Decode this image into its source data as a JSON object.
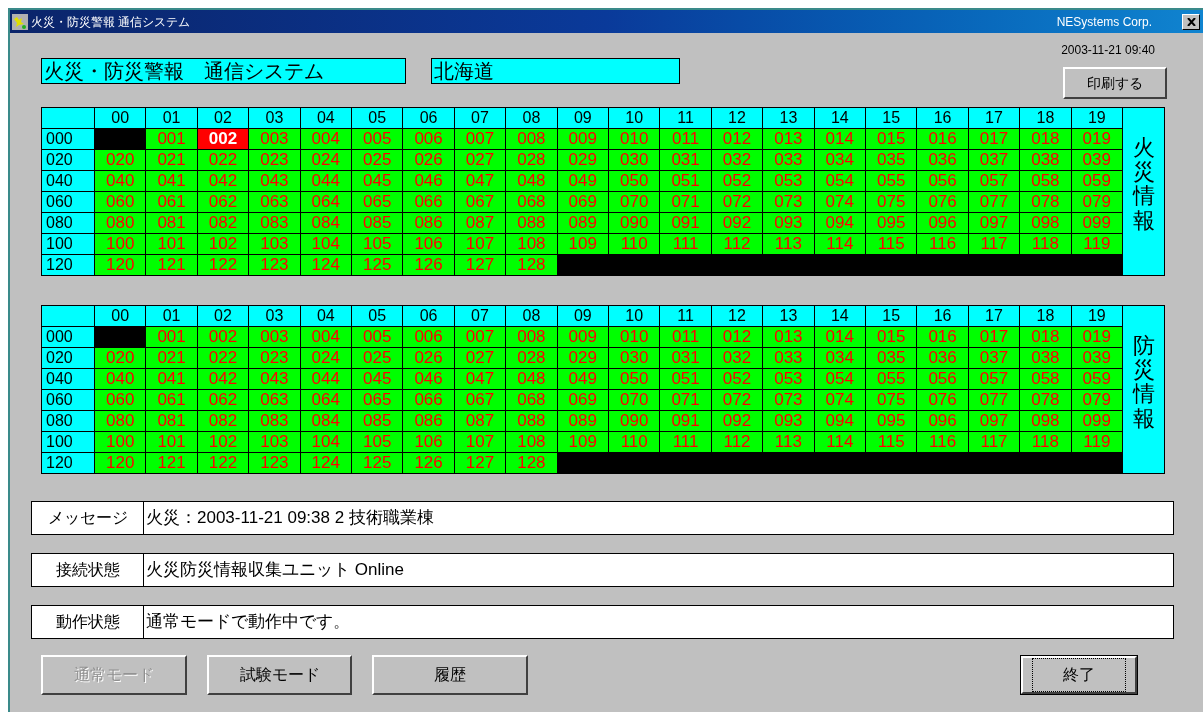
{
  "window": {
    "title": "火災・防災警報 通信システム",
    "vendor": "NESystems Corp."
  },
  "header": {
    "system_name": "火災・防災警報　通信システム",
    "region": "北海道",
    "timestamp": "2003-11-21 09:40",
    "print_button": "印刷する"
  },
  "panels": [
    {
      "side_label": "火災情報",
      "column_headers": [
        "00",
        "01",
        "02",
        "03",
        "04",
        "05",
        "06",
        "07",
        "08",
        "09",
        "10",
        "11",
        "12",
        "13",
        "14",
        "15",
        "16",
        "17",
        "18",
        "19"
      ],
      "row_headers": [
        "000",
        "020",
        "040",
        "060",
        "080",
        "100",
        "120"
      ],
      "cells": [
        {
          "kind": "empty"
        },
        {
          "label": "001",
          "kind": "normal"
        },
        {
          "label": "002",
          "kind": "alarm"
        },
        {
          "label": "003",
          "kind": "normal"
        },
        {
          "label": "004",
          "kind": "normal"
        },
        {
          "label": "005",
          "kind": "normal"
        },
        {
          "label": "006",
          "kind": "normal"
        },
        {
          "label": "007",
          "kind": "normal"
        },
        {
          "label": "008",
          "kind": "normal"
        },
        {
          "label": "009",
          "kind": "normal"
        },
        {
          "label": "010",
          "kind": "normal"
        },
        {
          "label": "011",
          "kind": "normal"
        },
        {
          "label": "012",
          "kind": "normal"
        },
        {
          "label": "013",
          "kind": "normal"
        },
        {
          "label": "014",
          "kind": "normal"
        },
        {
          "label": "015",
          "kind": "normal"
        },
        {
          "label": "016",
          "kind": "normal"
        },
        {
          "label": "017",
          "kind": "normal"
        },
        {
          "label": "018",
          "kind": "normal"
        },
        {
          "label": "019",
          "kind": "normal"
        },
        {
          "label": "020",
          "kind": "normal"
        },
        {
          "label": "021",
          "kind": "normal"
        },
        {
          "label": "022",
          "kind": "normal"
        },
        {
          "label": "023",
          "kind": "normal"
        },
        {
          "label": "024",
          "kind": "normal"
        },
        {
          "label": "025",
          "kind": "normal"
        },
        {
          "label": "026",
          "kind": "normal"
        },
        {
          "label": "027",
          "kind": "normal"
        },
        {
          "label": "028",
          "kind": "normal"
        },
        {
          "label": "029",
          "kind": "normal"
        },
        {
          "label": "030",
          "kind": "normal"
        },
        {
          "label": "031",
          "kind": "normal"
        },
        {
          "label": "032",
          "kind": "normal"
        },
        {
          "label": "033",
          "kind": "normal"
        },
        {
          "label": "034",
          "kind": "normal"
        },
        {
          "label": "035",
          "kind": "normal"
        },
        {
          "label": "036",
          "kind": "normal"
        },
        {
          "label": "037",
          "kind": "normal"
        },
        {
          "label": "038",
          "kind": "normal"
        },
        {
          "label": "039",
          "kind": "normal"
        },
        {
          "label": "040",
          "kind": "normal"
        },
        {
          "label": "041",
          "kind": "normal"
        },
        {
          "label": "042",
          "kind": "normal"
        },
        {
          "label": "043",
          "kind": "normal"
        },
        {
          "label": "044",
          "kind": "normal"
        },
        {
          "label": "045",
          "kind": "normal"
        },
        {
          "label": "046",
          "kind": "normal"
        },
        {
          "label": "047",
          "kind": "normal"
        },
        {
          "label": "048",
          "kind": "normal"
        },
        {
          "label": "049",
          "kind": "normal"
        },
        {
          "label": "050",
          "kind": "normal"
        },
        {
          "label": "051",
          "kind": "normal"
        },
        {
          "label": "052",
          "kind": "normal"
        },
        {
          "label": "053",
          "kind": "normal"
        },
        {
          "label": "054",
          "kind": "normal"
        },
        {
          "label": "055",
          "kind": "normal"
        },
        {
          "label": "056",
          "kind": "normal"
        },
        {
          "label": "057",
          "kind": "normal"
        },
        {
          "label": "058",
          "kind": "normal"
        },
        {
          "label": "059",
          "kind": "normal"
        },
        {
          "label": "060",
          "kind": "normal"
        },
        {
          "label": "061",
          "kind": "normal"
        },
        {
          "label": "062",
          "kind": "normal"
        },
        {
          "label": "063",
          "kind": "normal"
        },
        {
          "label": "064",
          "kind": "normal"
        },
        {
          "label": "065",
          "kind": "normal"
        },
        {
          "label": "066",
          "kind": "normal"
        },
        {
          "label": "067",
          "kind": "normal"
        },
        {
          "label": "068",
          "kind": "normal"
        },
        {
          "label": "069",
          "kind": "normal"
        },
        {
          "label": "070",
          "kind": "normal"
        },
        {
          "label": "071",
          "kind": "normal"
        },
        {
          "label": "072",
          "kind": "normal"
        },
        {
          "label": "073",
          "kind": "normal"
        },
        {
          "label": "074",
          "kind": "normal"
        },
        {
          "label": "075",
          "kind": "normal"
        },
        {
          "label": "076",
          "kind": "normal"
        },
        {
          "label": "077",
          "kind": "normal"
        },
        {
          "label": "078",
          "kind": "normal"
        },
        {
          "label": "079",
          "kind": "normal"
        },
        {
          "label": "080",
          "kind": "normal"
        },
        {
          "label": "081",
          "kind": "normal"
        },
        {
          "label": "082",
          "kind": "normal"
        },
        {
          "label": "083",
          "kind": "normal"
        },
        {
          "label": "084",
          "kind": "normal"
        },
        {
          "label": "085",
          "kind": "normal"
        },
        {
          "label": "086",
          "kind": "normal"
        },
        {
          "label": "087",
          "kind": "normal"
        },
        {
          "label": "088",
          "kind": "normal"
        },
        {
          "label": "089",
          "kind": "normal"
        },
        {
          "label": "090",
          "kind": "normal"
        },
        {
          "label": "091",
          "kind": "normal"
        },
        {
          "label": "092",
          "kind": "normal"
        },
        {
          "label": "093",
          "kind": "normal"
        },
        {
          "label": "094",
          "kind": "normal"
        },
        {
          "label": "095",
          "kind": "normal"
        },
        {
          "label": "096",
          "kind": "normal"
        },
        {
          "label": "097",
          "kind": "normal"
        },
        {
          "label": "098",
          "kind": "normal"
        },
        {
          "label": "099",
          "kind": "normal"
        },
        {
          "label": "100",
          "kind": "normal"
        },
        {
          "label": "101",
          "kind": "normal"
        },
        {
          "label": "102",
          "kind": "normal"
        },
        {
          "label": "103",
          "kind": "normal"
        },
        {
          "label": "104",
          "kind": "normal"
        },
        {
          "label": "105",
          "kind": "normal"
        },
        {
          "label": "106",
          "kind": "normal"
        },
        {
          "label": "107",
          "kind": "normal"
        },
        {
          "label": "108",
          "kind": "normal"
        },
        {
          "label": "109",
          "kind": "normal"
        },
        {
          "label": "110",
          "kind": "normal"
        },
        {
          "label": "111",
          "kind": "normal"
        },
        {
          "label": "112",
          "kind": "normal"
        },
        {
          "label": "113",
          "kind": "normal"
        },
        {
          "label": "114",
          "kind": "normal"
        },
        {
          "label": "115",
          "kind": "normal"
        },
        {
          "label": "116",
          "kind": "normal"
        },
        {
          "label": "117",
          "kind": "normal"
        },
        {
          "label": "118",
          "kind": "normal"
        },
        {
          "label": "119",
          "kind": "normal"
        },
        {
          "label": "120",
          "kind": "normal"
        },
        {
          "label": "121",
          "kind": "normal"
        },
        {
          "label": "122",
          "kind": "normal"
        },
        {
          "label": "123",
          "kind": "normal"
        },
        {
          "label": "124",
          "kind": "normal"
        },
        {
          "label": "125",
          "kind": "normal"
        },
        {
          "label": "126",
          "kind": "normal"
        },
        {
          "label": "127",
          "kind": "normal"
        },
        {
          "label": "128",
          "kind": "normal"
        }
      ]
    },
    {
      "side_label": "防災情報",
      "column_headers": [
        "00",
        "01",
        "02",
        "03",
        "04",
        "05",
        "06",
        "07",
        "08",
        "09",
        "10",
        "11",
        "12",
        "13",
        "14",
        "15",
        "16",
        "17",
        "18",
        "19"
      ],
      "row_headers": [
        "000",
        "020",
        "040",
        "060",
        "080",
        "100",
        "120"
      ],
      "cells": [
        {
          "kind": "empty"
        },
        {
          "label": "001",
          "kind": "normal"
        },
        {
          "label": "002",
          "kind": "normal"
        },
        {
          "label": "003",
          "kind": "normal"
        },
        {
          "label": "004",
          "kind": "normal"
        },
        {
          "label": "005",
          "kind": "normal"
        },
        {
          "label": "006",
          "kind": "normal"
        },
        {
          "label": "007",
          "kind": "normal"
        },
        {
          "label": "008",
          "kind": "normal"
        },
        {
          "label": "009",
          "kind": "normal"
        },
        {
          "label": "010",
          "kind": "normal"
        },
        {
          "label": "011",
          "kind": "normal"
        },
        {
          "label": "012",
          "kind": "normal"
        },
        {
          "label": "013",
          "kind": "normal"
        },
        {
          "label": "014",
          "kind": "normal"
        },
        {
          "label": "015",
          "kind": "normal"
        },
        {
          "label": "016",
          "kind": "normal"
        },
        {
          "label": "017",
          "kind": "normal"
        },
        {
          "label": "018",
          "kind": "normal"
        },
        {
          "label": "019",
          "kind": "normal"
        },
        {
          "label": "020",
          "kind": "normal"
        },
        {
          "label": "021",
          "kind": "normal"
        },
        {
          "label": "022",
          "kind": "normal"
        },
        {
          "label": "023",
          "kind": "normal"
        },
        {
          "label": "024",
          "kind": "normal"
        },
        {
          "label": "025",
          "kind": "normal"
        },
        {
          "label": "026",
          "kind": "normal"
        },
        {
          "label": "027",
          "kind": "normal"
        },
        {
          "label": "028",
          "kind": "normal"
        },
        {
          "label": "029",
          "kind": "normal"
        },
        {
          "label": "030",
          "kind": "normal"
        },
        {
          "label": "031",
          "kind": "normal"
        },
        {
          "label": "032",
          "kind": "normal"
        },
        {
          "label": "033",
          "kind": "normal"
        },
        {
          "label": "034",
          "kind": "normal"
        },
        {
          "label": "035",
          "kind": "normal"
        },
        {
          "label": "036",
          "kind": "normal"
        },
        {
          "label": "037",
          "kind": "normal"
        },
        {
          "label": "038",
          "kind": "normal"
        },
        {
          "label": "039",
          "kind": "normal"
        },
        {
          "label": "040",
          "kind": "normal"
        },
        {
          "label": "041",
          "kind": "normal"
        },
        {
          "label": "042",
          "kind": "normal"
        },
        {
          "label": "043",
          "kind": "normal"
        },
        {
          "label": "044",
          "kind": "normal"
        },
        {
          "label": "045",
          "kind": "normal"
        },
        {
          "label": "046",
          "kind": "normal"
        },
        {
          "label": "047",
          "kind": "normal"
        },
        {
          "label": "048",
          "kind": "normal"
        },
        {
          "label": "049",
          "kind": "normal"
        },
        {
          "label": "050",
          "kind": "normal"
        },
        {
          "label": "051",
          "kind": "normal"
        },
        {
          "label": "052",
          "kind": "normal"
        },
        {
          "label": "053",
          "kind": "normal"
        },
        {
          "label": "054",
          "kind": "normal"
        },
        {
          "label": "055",
          "kind": "normal"
        },
        {
          "label": "056",
          "kind": "normal"
        },
        {
          "label": "057",
          "kind": "normal"
        },
        {
          "label": "058",
          "kind": "normal"
        },
        {
          "label": "059",
          "kind": "normal"
        },
        {
          "label": "060",
          "kind": "normal"
        },
        {
          "label": "061",
          "kind": "normal"
        },
        {
          "label": "062",
          "kind": "normal"
        },
        {
          "label": "063",
          "kind": "normal"
        },
        {
          "label": "064",
          "kind": "normal"
        },
        {
          "label": "065",
          "kind": "normal"
        },
        {
          "label": "066",
          "kind": "normal"
        },
        {
          "label": "067",
          "kind": "normal"
        },
        {
          "label": "068",
          "kind": "normal"
        },
        {
          "label": "069",
          "kind": "normal"
        },
        {
          "label": "070",
          "kind": "normal"
        },
        {
          "label": "071",
          "kind": "normal"
        },
        {
          "label": "072",
          "kind": "normal"
        },
        {
          "label": "073",
          "kind": "normal"
        },
        {
          "label": "074",
          "kind": "normal"
        },
        {
          "label": "075",
          "kind": "normal"
        },
        {
          "label": "076",
          "kind": "normal"
        },
        {
          "label": "077",
          "kind": "normal"
        },
        {
          "label": "078",
          "kind": "normal"
        },
        {
          "label": "079",
          "kind": "normal"
        },
        {
          "label": "080",
          "kind": "normal"
        },
        {
          "label": "081",
          "kind": "normal"
        },
        {
          "label": "082",
          "kind": "normal"
        },
        {
          "label": "083",
          "kind": "normal"
        },
        {
          "label": "084",
          "kind": "normal"
        },
        {
          "label": "085",
          "kind": "normal"
        },
        {
          "label": "086",
          "kind": "normal"
        },
        {
          "label": "087",
          "kind": "normal"
        },
        {
          "label": "088",
          "kind": "normal"
        },
        {
          "label": "089",
          "kind": "normal"
        },
        {
          "label": "090",
          "kind": "normal"
        },
        {
          "label": "091",
          "kind": "normal"
        },
        {
          "label": "092",
          "kind": "normal"
        },
        {
          "label": "093",
          "kind": "normal"
        },
        {
          "label": "094",
          "kind": "normal"
        },
        {
          "label": "095",
          "kind": "normal"
        },
        {
          "label": "096",
          "kind": "normal"
        },
        {
          "label": "097",
          "kind": "normal"
        },
        {
          "label": "098",
          "kind": "normal"
        },
        {
          "label": "099",
          "kind": "normal"
        },
        {
          "label": "100",
          "kind": "normal"
        },
        {
          "label": "101",
          "kind": "normal"
        },
        {
          "label": "102",
          "kind": "normal"
        },
        {
          "label": "103",
          "kind": "normal"
        },
        {
          "label": "104",
          "kind": "normal"
        },
        {
          "label": "105",
          "kind": "normal"
        },
        {
          "label": "106",
          "kind": "normal"
        },
        {
          "label": "107",
          "kind": "normal"
        },
        {
          "label": "108",
          "kind": "normal"
        },
        {
          "label": "109",
          "kind": "normal"
        },
        {
          "label": "110",
          "kind": "normal"
        },
        {
          "label": "111",
          "kind": "normal"
        },
        {
          "label": "112",
          "kind": "normal"
        },
        {
          "label": "113",
          "kind": "normal"
        },
        {
          "label": "114",
          "kind": "normal"
        },
        {
          "label": "115",
          "kind": "normal"
        },
        {
          "label": "116",
          "kind": "normal"
        },
        {
          "label": "117",
          "kind": "normal"
        },
        {
          "label": "118",
          "kind": "normal"
        },
        {
          "label": "119",
          "kind": "normal"
        },
        {
          "label": "120",
          "kind": "normal"
        },
        {
          "label": "121",
          "kind": "normal"
        },
        {
          "label": "122",
          "kind": "normal"
        },
        {
          "label": "123",
          "kind": "normal"
        },
        {
          "label": "124",
          "kind": "normal"
        },
        {
          "label": "125",
          "kind": "normal"
        },
        {
          "label": "126",
          "kind": "normal"
        },
        {
          "label": "127",
          "kind": "normal"
        },
        {
          "label": "128",
          "kind": "normal"
        }
      ]
    }
  ],
  "status_fields": [
    {
      "label": "メッセージ",
      "value": "火災：2003-11-21 09:38 2 技術職業棟"
    },
    {
      "label": "接続状態",
      "value": "火災防災情報収集ユニット Online"
    },
    {
      "label": "動作状態",
      "value": "通常モードで動作中です。"
    }
  ],
  "mode_buttons": [
    {
      "label": "通常モード",
      "disabled": true
    },
    {
      "label": "試験モード",
      "disabled": false
    },
    {
      "label": "履歴",
      "disabled": false
    }
  ],
  "exit_button": {
    "label": "終了",
    "focused": true
  }
}
